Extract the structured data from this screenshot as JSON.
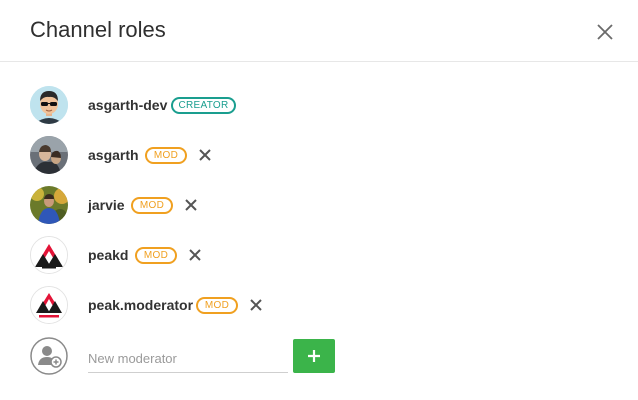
{
  "dialog": {
    "title": "Channel roles"
  },
  "roles": [
    {
      "username": "asgarth-dev",
      "role": "CREATOR",
      "removable": false,
      "avatar": "cartoon-sunglasses-avatar"
    },
    {
      "username": "asgarth",
      "role": "MOD",
      "removable": true,
      "avatar": "photo-avatar"
    },
    {
      "username": "jarvie",
      "role": "MOD",
      "removable": true,
      "avatar": "photo-avatar"
    },
    {
      "username": "peakd",
      "role": "MOD",
      "removable": true,
      "avatar": "peakd-logo-avatar"
    },
    {
      "username": "peak.moderator",
      "role": "MOD",
      "removable": true,
      "avatar": "peakd-moderator-logo-avatar"
    }
  ],
  "new_moderator": {
    "value": "",
    "placeholder": "New moderator"
  },
  "colors": {
    "creator_badge": "#1a9e8f",
    "mod_badge": "#f0a020",
    "add_button": "#3bb44a"
  },
  "icons": {
    "close": "close-icon",
    "remove": "close-icon",
    "add": "plus-icon",
    "add_user": "add-user-icon"
  }
}
